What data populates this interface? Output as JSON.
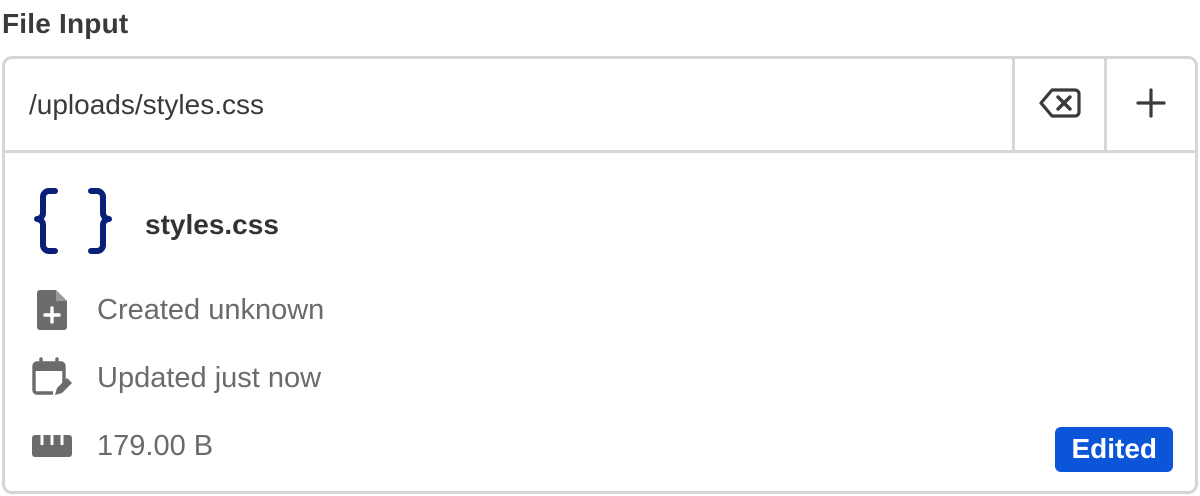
{
  "field": {
    "label": "File Input",
    "path_value": "/uploads/styles.css"
  },
  "toolbar": {
    "clear_icon": "backspace-x-icon",
    "add_icon": "plus-icon"
  },
  "file": {
    "icon": "curly-braces-icon",
    "icon_color": "#0a1f7a",
    "name": "styles.css",
    "created": "Created unknown",
    "updated": "Updated just now",
    "size": "179.00 B",
    "status_badge": "Edited",
    "badge_color": "#0b55d8"
  }
}
